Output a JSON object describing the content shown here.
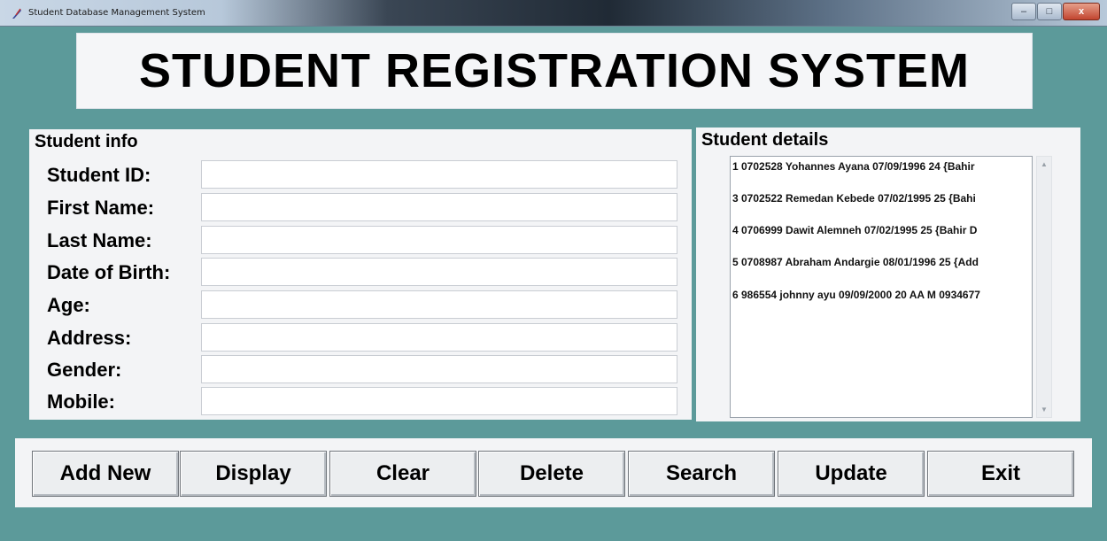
{
  "window": {
    "title": "Student Database Management System",
    "controls": [
      "–",
      "□",
      "x"
    ]
  },
  "banner": {
    "title": "STUDENT REGISTRATION SYSTEM"
  },
  "student_info": {
    "label": "Student info",
    "fields": [
      {
        "label": "Student ID:",
        "value": ""
      },
      {
        "label": "First Name:",
        "value": ""
      },
      {
        "label": "Last Name:",
        "value": ""
      },
      {
        "label": "Date of Birth:",
        "value": ""
      },
      {
        "label": "Age:",
        "value": ""
      },
      {
        "label": "Address:",
        "value": ""
      },
      {
        "label": "Gender:",
        "value": ""
      },
      {
        "label": "Mobile:",
        "value": ""
      }
    ]
  },
  "student_details": {
    "label": "Student details",
    "records": [
      "1 0702528 Yohannes Ayana 07/09/1996 24 {Bahir",
      "3 0702522 Remedan Kebede 07/02/1995 25 {Bahi",
      "4 0706999 Dawit Alemneh 07/02/1995 25 {Bahir D",
      "5 0708987 Abraham Andargie 08/01/1996 25 {Add",
      "6 986554 johnny ayu 09/09/2000 20 AA M 0934677"
    ],
    "scroll_up": "▲",
    "scroll_down": "▼"
  },
  "buttons": {
    "add_new": "Add New",
    "display": "Display",
    "clear": "Clear",
    "delete": "Delete",
    "search": "Search",
    "update": "Update",
    "exit": "Exit"
  }
}
